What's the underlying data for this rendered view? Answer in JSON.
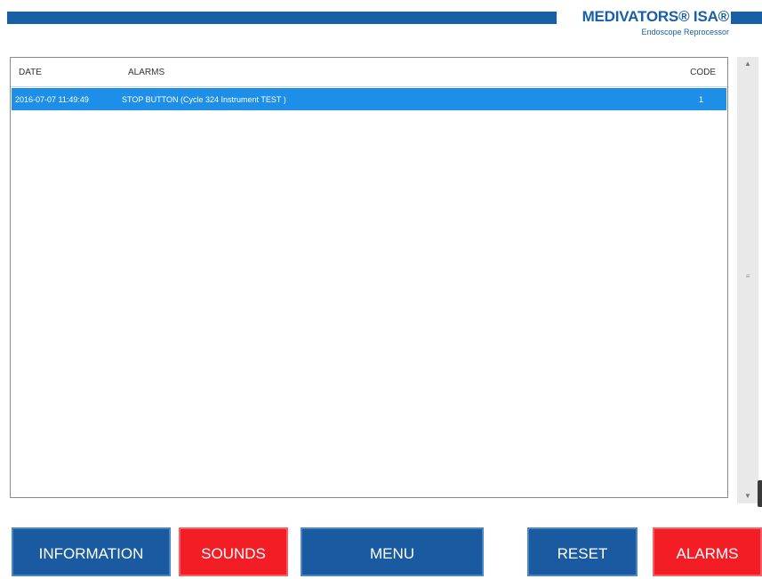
{
  "header": {
    "brand": "MEDIVATORS® ISA®",
    "subtitle": "Endoscope Reprocessor"
  },
  "colors": {
    "brand_blue": "#1760a8",
    "selected_row": "#1e8fe8",
    "button_blue": "#1a5aa0",
    "button_red": "#f31d25"
  },
  "alarm_table": {
    "columns": {
      "date": "DATE",
      "alarms": "ALARMS",
      "code": "CODE"
    },
    "rows": [
      {
        "date": "2016-07-07 11:49:49",
        "alarm": "STOP BUTTON (Cycle 324 Instrument TEST )",
        "code": "1",
        "selected": true
      }
    ]
  },
  "scrollbar": {
    "up_icon": "scroll-up-arrow",
    "down_icon": "scroll-down-arrow",
    "up_glyph": "▲",
    "down_glyph": "▼",
    "grip_glyph": "≡"
  },
  "buttons": {
    "information": "INFORMATION",
    "sounds": "SOUNDS",
    "menu": "MENU",
    "reset": "RESET",
    "alarms": "ALARMS"
  }
}
